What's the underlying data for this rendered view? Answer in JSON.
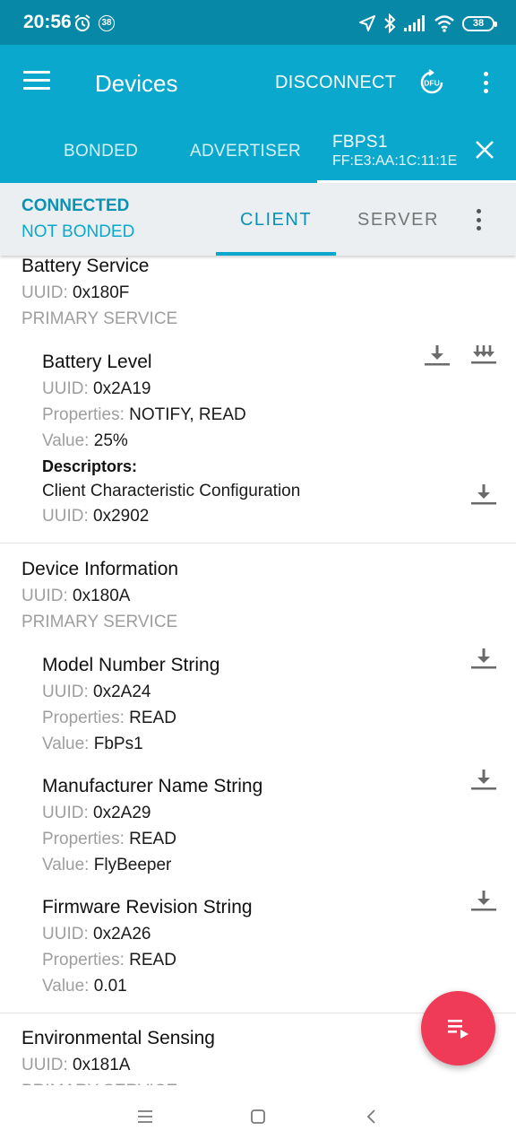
{
  "status_bar": {
    "time": "20:56",
    "notification_badge": "38",
    "battery": "38",
    "icons": [
      "alarm-icon",
      "location-icon",
      "bluetooth-icon",
      "signal-icon",
      "wifi-icon",
      "battery-icon"
    ]
  },
  "app_bar": {
    "title": "Devices",
    "disconnect_label": "DISCONNECT",
    "dfu_label": "DFU",
    "bg_color": "#0aa8cd"
  },
  "device_tabs": {
    "bonded": "BONDED",
    "advertiser": "ADVERTISER",
    "active_name": "FBPS1",
    "active_address": "FF:E3:AA:1C:11:1E"
  },
  "connection": {
    "state": "CONNECTED",
    "bond_state": "NOT BONDED",
    "tab_client": "CLIENT",
    "tab_server": "SERVER"
  },
  "labels": {
    "uuid": "UUID:",
    "properties": "Properties:",
    "value": "Value:",
    "descriptors": "Descriptors:"
  },
  "services": [
    {
      "name": "Battery Service",
      "uuid": "0x180F",
      "type": "PRIMARY SERVICE",
      "characteristics": [
        {
          "name": "Battery Level",
          "uuid": "0x2A19",
          "properties": "NOTIFY, READ",
          "value": "25%",
          "descriptor": {
            "name": "Client Characteristic Configuration",
            "uuid": "0x2902"
          }
        }
      ]
    },
    {
      "name": "Device Information",
      "uuid": "0x180A",
      "type": "PRIMARY SERVICE",
      "characteristics": [
        {
          "name": "Model Number String",
          "uuid": "0x2A24",
          "properties": "READ",
          "value": "FbPs1"
        },
        {
          "name": "Manufacturer Name String",
          "uuid": "0x2A29",
          "properties": "READ",
          "value": "FlyBeeper"
        },
        {
          "name": "Firmware Revision String",
          "uuid": "0x2A26",
          "properties": "READ",
          "value": "0.01"
        }
      ]
    },
    {
      "name": "Environmental Sensing",
      "uuid": "0x181A",
      "type": "PRIMARY SERVICE"
    }
  ],
  "colors": {
    "status_bar": "#0788a6",
    "accent": "#0aa8cd",
    "fab": "#ef3b57",
    "label_gray": "#9e9e9e"
  }
}
